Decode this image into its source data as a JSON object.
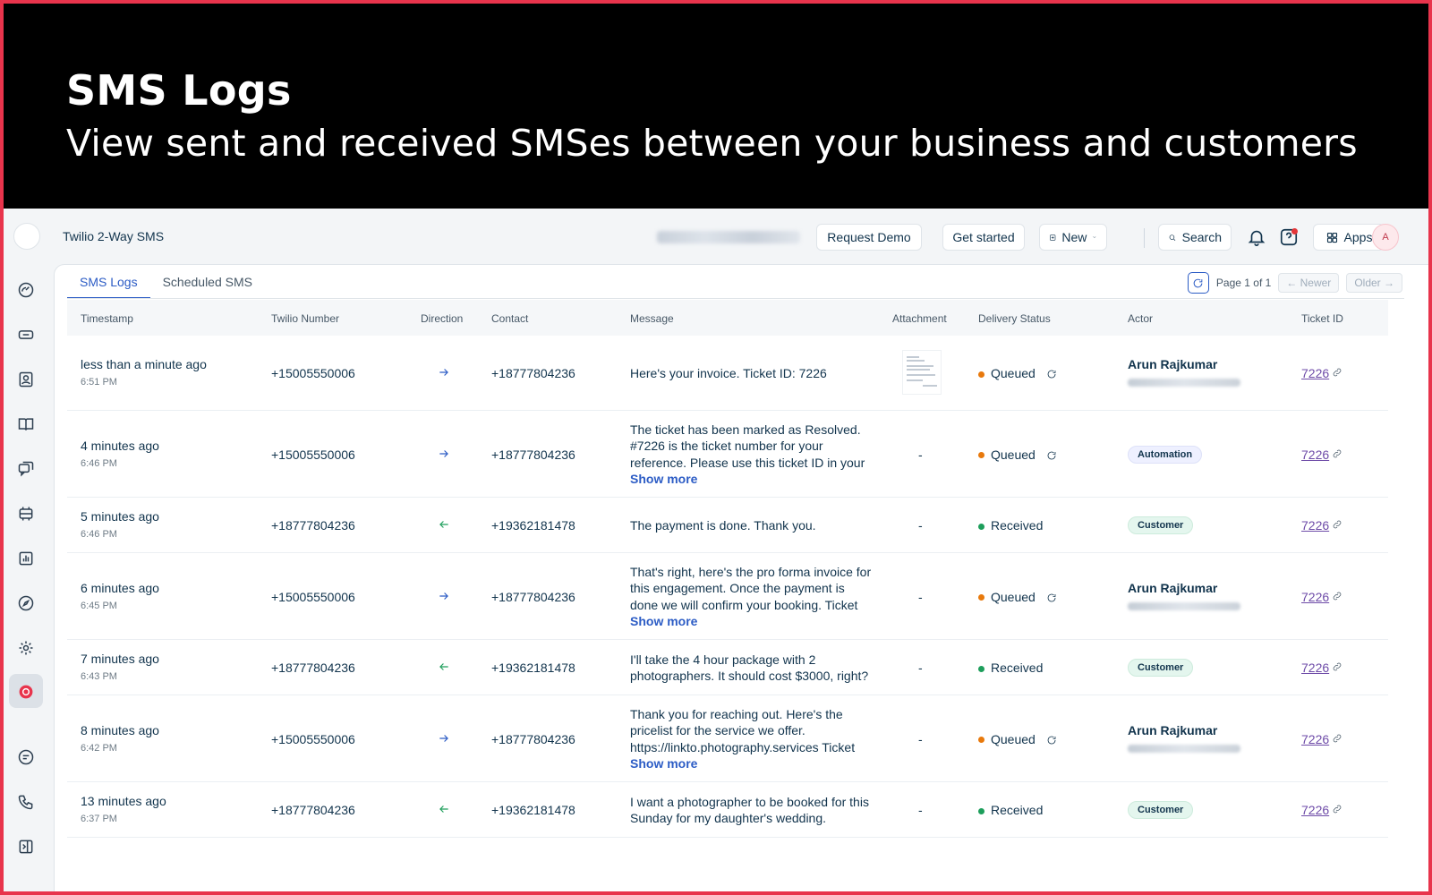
{
  "hero": {
    "title": "SMS Logs",
    "subtitle": "View sent and received SMSes between your business and customers"
  },
  "topbar": {
    "app_title": "Twilio 2-Way SMS",
    "request_demo": "Request Demo",
    "get_started": "Get started",
    "new_label": "New",
    "search_label": "Search",
    "apps_label": "Apps",
    "avatar_initial": "A"
  },
  "tabs": [
    {
      "label": "SMS Logs",
      "active": true
    },
    {
      "label": "Scheduled SMS",
      "active": false
    }
  ],
  "pager": {
    "page_text": "Page 1 of 1",
    "newer": "← Newer",
    "older": "Older →"
  },
  "columns": [
    "Timestamp",
    "Twilio Number",
    "Direction",
    "Contact",
    "Message",
    "Attachment",
    "Delivery Status",
    "Actor",
    "Ticket ID"
  ],
  "show_more_label": "Show more",
  "rows": [
    {
      "relative": "less than a minute ago",
      "time": "6:51 PM",
      "twilio": "+15005550006",
      "direction": "outgoing",
      "contact": "+18777804236",
      "message": [
        "Here's your invoice. Ticket ID: 7226"
      ],
      "show_more": false,
      "attachment": "thumbnail",
      "status": "Queued",
      "actor_type": "agent",
      "actor": "Arun Rajkumar",
      "ticket": "7226"
    },
    {
      "relative": "4 minutes ago",
      "time": "6:46 PM",
      "twilio": "+15005550006",
      "direction": "outgoing",
      "contact": "+18777804236",
      "message": [
        "The ticket has been marked as Resolved.",
        "#7226 is the ticket number for your",
        "reference. Please use this ticket ID in your"
      ],
      "show_more": true,
      "attachment": "-",
      "status": "Queued",
      "actor_type": "badge",
      "actor": "Automation",
      "ticket": "7226"
    },
    {
      "relative": "5 minutes ago",
      "time": "6:46 PM",
      "twilio": "+18777804236",
      "direction": "incoming",
      "contact": "+19362181478",
      "message": [
        "The payment is done. Thank you."
      ],
      "show_more": false,
      "attachment": "-",
      "status": "Received",
      "actor_type": "badge",
      "actor": "Customer",
      "ticket": "7226"
    },
    {
      "relative": "6 minutes ago",
      "time": "6:45 PM",
      "twilio": "+15005550006",
      "direction": "outgoing",
      "contact": "+18777804236",
      "message": [
        "That's right, here's the pro forma invoice for",
        "this engagement. Once the payment is",
        "done we will confirm your booking. Ticket"
      ],
      "show_more": true,
      "attachment": "-",
      "status": "Queued",
      "actor_type": "agent",
      "actor": "Arun Rajkumar",
      "ticket": "7226"
    },
    {
      "relative": "7 minutes ago",
      "time": "6:43 PM",
      "twilio": "+18777804236",
      "direction": "incoming",
      "contact": "+19362181478",
      "message": [
        "I'll take the 4 hour package with 2",
        "photographers. It should cost $3000, right?"
      ],
      "show_more": false,
      "attachment": "-",
      "status": "Received",
      "actor_type": "badge",
      "actor": "Customer",
      "ticket": "7226"
    },
    {
      "relative": "8 minutes ago",
      "time": "6:42 PM",
      "twilio": "+15005550006",
      "direction": "outgoing",
      "contact": "+18777804236",
      "message": [
        "Thank you for reaching out. Here's the",
        "pricelist for the service we offer.",
        "https://linkto.photography.services Ticket"
      ],
      "show_more": true,
      "attachment": "-",
      "status": "Queued",
      "actor_type": "agent",
      "actor": "Arun Rajkumar",
      "ticket": "7226"
    },
    {
      "relative": "13 minutes ago",
      "time": "6:37 PM",
      "twilio": "+18777804236",
      "direction": "incoming",
      "contact": "+19362181478",
      "message": [
        "I want a photographer to be booked for this",
        "Sunday for my daughter's wedding."
      ],
      "show_more": false,
      "attachment": "-",
      "status": "Received",
      "actor_type": "badge",
      "actor": "Customer",
      "ticket": "7226"
    }
  ],
  "colors": {
    "accent": "#2c5cc5",
    "queued": "#e8790c",
    "received": "#1d9e5b",
    "outgoing_arrow": "#2c5cc5",
    "incoming_arrow": "#1d9e5b",
    "ticket_link": "#6e4ba8",
    "frame": "#e8344c"
  },
  "sidebar_icons": [
    "dashboard-icon",
    "tickets-icon",
    "contacts-icon",
    "solutions-icon",
    "conversations-icon",
    "assets-icon",
    "reports-icon",
    "compass-icon",
    "settings-icon",
    "twilio-app-icon",
    "chat-icon",
    "phone-icon",
    "collapse-icon"
  ]
}
